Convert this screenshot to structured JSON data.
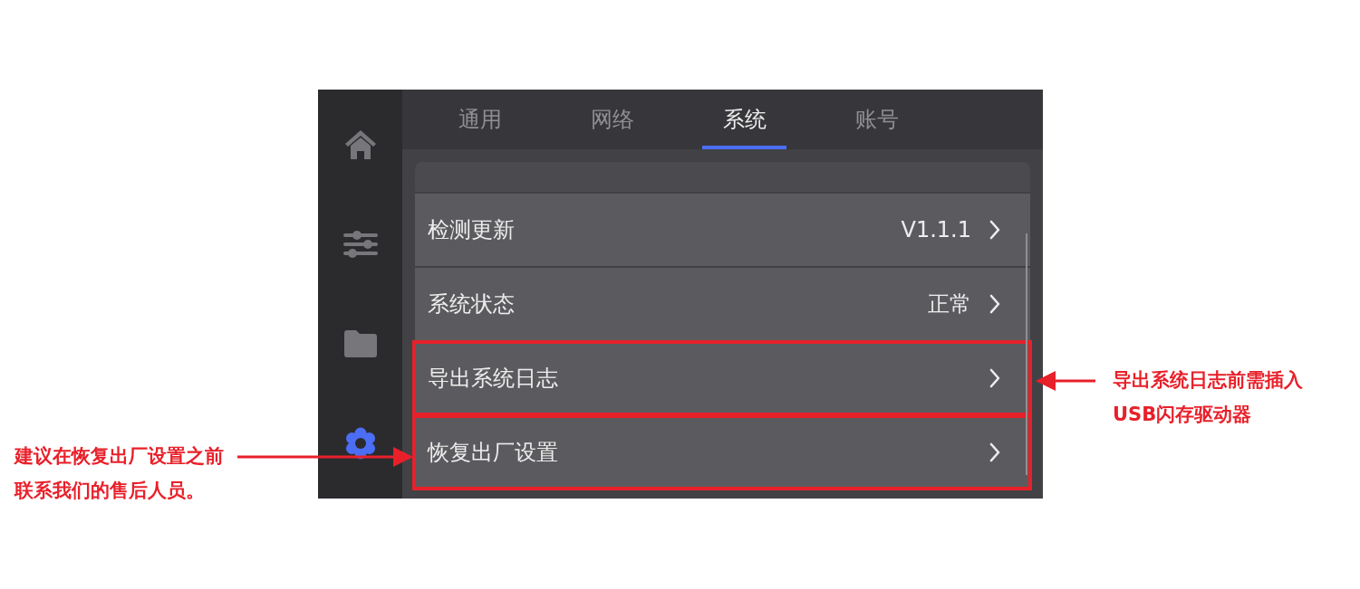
{
  "sidebar": {
    "items": [
      {
        "kind": "home",
        "selected": false
      },
      {
        "kind": "sliders",
        "selected": false
      },
      {
        "kind": "folder",
        "selected": false
      },
      {
        "kind": "gear",
        "selected": true
      }
    ]
  },
  "tabs": [
    {
      "label": "通用",
      "selected": false
    },
    {
      "label": "网络",
      "selected": false
    },
    {
      "label": "系统",
      "selected": true
    },
    {
      "label": "账号",
      "selected": false
    }
  ],
  "settings": {
    "rows": [
      {
        "label": "检测更新",
        "value": "V1.1.1",
        "highlighted": false
      },
      {
        "label": "系统状态",
        "value": "正常",
        "highlighted": false
      },
      {
        "label": "导出系统日志",
        "highlighted": true
      },
      {
        "label": "恢复出厂设置",
        "highlighted": true
      }
    ]
  },
  "annotations": [
    {
      "kind": "leftward",
      "text": "导出系统日志前需插入USB闪存驱动器"
    },
    {
      "kind": "rightward",
      "text": "建议在恢复出厂设置之前联系我们的售后人员。"
    }
  ]
}
